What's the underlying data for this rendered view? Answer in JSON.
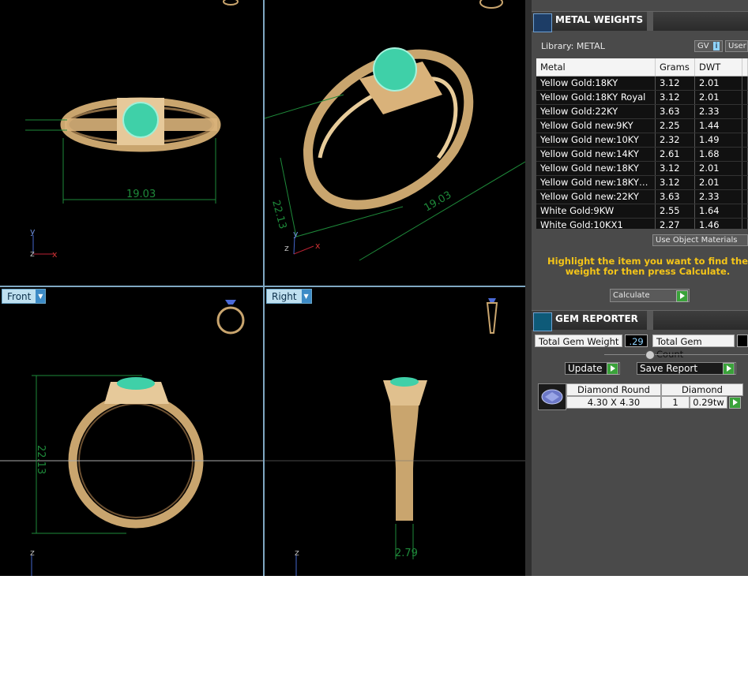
{
  "viewports": {
    "top": {
      "dim_width": "19.03"
    },
    "perspective": {
      "dim_height": "22.13",
      "dim_width": "19.03"
    },
    "front": {
      "label": "Front",
      "dim_height": "22.13"
    },
    "right": {
      "label": "Right",
      "dim_width": "2.79"
    }
  },
  "axes": {
    "x": "x",
    "y": "y",
    "z": "z"
  },
  "metal_weights": {
    "title": "METAL WEIGHTS",
    "library_label": "Library: METAL",
    "gv_label": "GV",
    "user_label": "User",
    "columns": [
      "Metal",
      "Grams",
      "DWT"
    ],
    "rows": [
      {
        "metal": "Yellow Gold:18KY",
        "grams": "3.12",
        "dwt": "2.01"
      },
      {
        "metal": "Yellow Gold:18KY Royal",
        "grams": "3.12",
        "dwt": "2.01"
      },
      {
        "metal": "Yellow Gold:22KY",
        "grams": "3.63",
        "dwt": "2.33"
      },
      {
        "metal": "Yellow Gold new:9KY",
        "grams": "2.25",
        "dwt": "1.44"
      },
      {
        "metal": "Yellow Gold new:10KY",
        "grams": "2.32",
        "dwt": "1.49"
      },
      {
        "metal": "Yellow Gold new:14KY",
        "grams": "2.61",
        "dwt": "1.68"
      },
      {
        "metal": "Yellow Gold new:18KY",
        "grams": "3.12",
        "dwt": "2.01"
      },
      {
        "metal": "Yellow Gold new:18KY…",
        "grams": "3.12",
        "dwt": "2.01"
      },
      {
        "metal": "Yellow Gold new:22KY",
        "grams": "3.63",
        "dwt": "2.33"
      },
      {
        "metal": "White Gold:9KW",
        "grams": "2.55",
        "dwt": "1.64"
      },
      {
        "metal": "White Gold:10KX1",
        "grams": "2.27",
        "dwt": "1.46"
      }
    ],
    "use_object_materials": "Use Object Materials",
    "hint": "Highlight the item you want to find the weight for then press Calculate.",
    "calculate_label": "Calculate"
  },
  "gem_reporter": {
    "title": "GEM REPORTER",
    "total_weight_label": "Total Gem Weight",
    "total_weight_value": ".29",
    "total_count_label": "Total Gem Count",
    "total_count_value": "",
    "update_label": "Update",
    "save_report_label": "Save Report",
    "gem": {
      "name": "Diamond Round",
      "material": "Diamond",
      "size": "4.30 X 4.30",
      "count": "1",
      "weight": "0.29tw"
    }
  },
  "colors": {
    "accent": "#3aa23a",
    "hint": "#f5c518",
    "viewport_bg": "#000000",
    "gold": "#d9b27a",
    "gem": "#3fd0a8",
    "dim": "#1e8a3a"
  }
}
